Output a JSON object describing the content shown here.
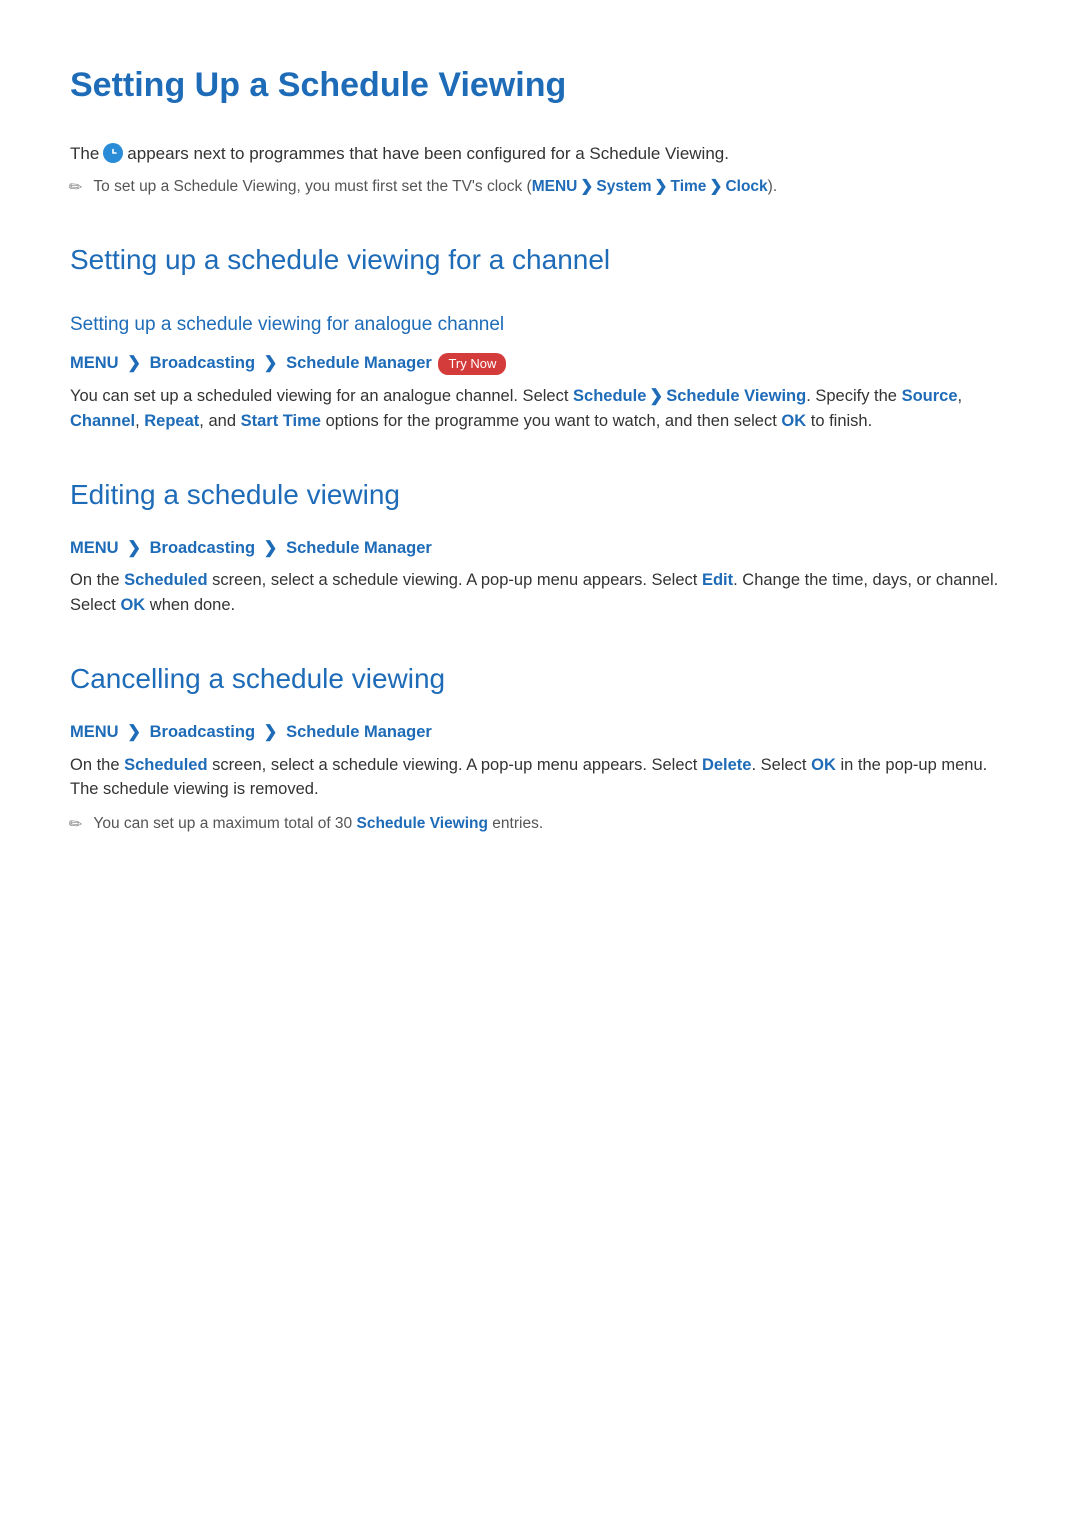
{
  "title": "Setting Up a Schedule Viewing",
  "intro": {
    "pre": "The",
    "post": "appears next to programmes that have been configured for a Schedule Viewing."
  },
  "clock_note": {
    "lead": "To set up a Schedule Viewing, you must first set the TV's clock (",
    "menu": "MENU",
    "system": "System",
    "time": "Time",
    "clock": "Clock",
    "tail": ")."
  },
  "section1": {
    "heading": "Setting up a schedule viewing for a channel",
    "analogue": {
      "heading": "Setting up a schedule viewing for analogue channel",
      "nav": {
        "menu": "MENU",
        "a": "Broadcasting",
        "b": "Schedule Manager"
      },
      "trynow": "Try Now",
      "p1a": "You can set up a scheduled viewing for an analogue channel. Select ",
      "schedule": "Schedule",
      "schedule_viewing": "Schedule Viewing",
      "p1b": ". Specify the ",
      "source": "Source",
      "comma1": ", ",
      "channel": "Channel",
      "comma2": ", ",
      "repeat": "Repeat",
      "comma3": ", and ",
      "start_time": "Start Time",
      "p1c": " options for the programme you want to watch, and then select ",
      "ok": "OK",
      "p1d": " to finish."
    }
  },
  "section2": {
    "heading": "Editing a schedule viewing",
    "nav": {
      "menu": "MENU",
      "a": "Broadcasting",
      "b": "Schedule Manager"
    },
    "p_a": "On the ",
    "scheduled": "Scheduled",
    "p_b": " screen, select a schedule viewing. A pop-up menu appears. Select ",
    "edit": "Edit",
    "p_c": ". Change the time, days, or channel. Select ",
    "ok": "OK",
    "p_d": " when done."
  },
  "section3": {
    "heading": "Cancelling a schedule viewing",
    "nav": {
      "menu": "MENU",
      "a": "Broadcasting",
      "b": "Schedule Manager"
    },
    "p_a": "On the ",
    "scheduled": "Scheduled",
    "p_b": " screen, select a schedule viewing. A pop-up menu appears. Select ",
    "delete": "Delete",
    "p_c": ". Select ",
    "ok": "OK",
    "p_d": " in the pop-up menu. The schedule viewing is removed."
  },
  "bottom_note": {
    "a": "You can set up a maximum total of 30 ",
    "sv": "Schedule Viewing",
    "b": " entries."
  }
}
